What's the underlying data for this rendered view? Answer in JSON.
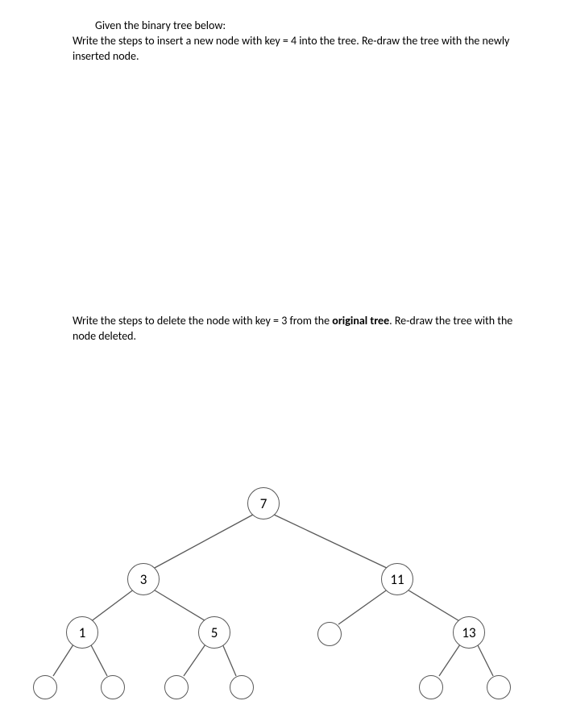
{
  "question1": {
    "line1": "Given the binary tree below:",
    "line2": "Write the steps to insert a new node with key = 4 into the tree.  Re-draw the tree with the newly",
    "line3": "inserted node."
  },
  "question2": {
    "part_a": "Write the steps to delete the node with key = 3 from the ",
    "bold": "original tree",
    "part_b": ".  Re-draw the tree with the",
    "line2": "node deleted."
  },
  "tree": {
    "root": "7",
    "left": "3",
    "right": "11",
    "left_left": "1",
    "left_right": "5",
    "right_right": "13"
  }
}
